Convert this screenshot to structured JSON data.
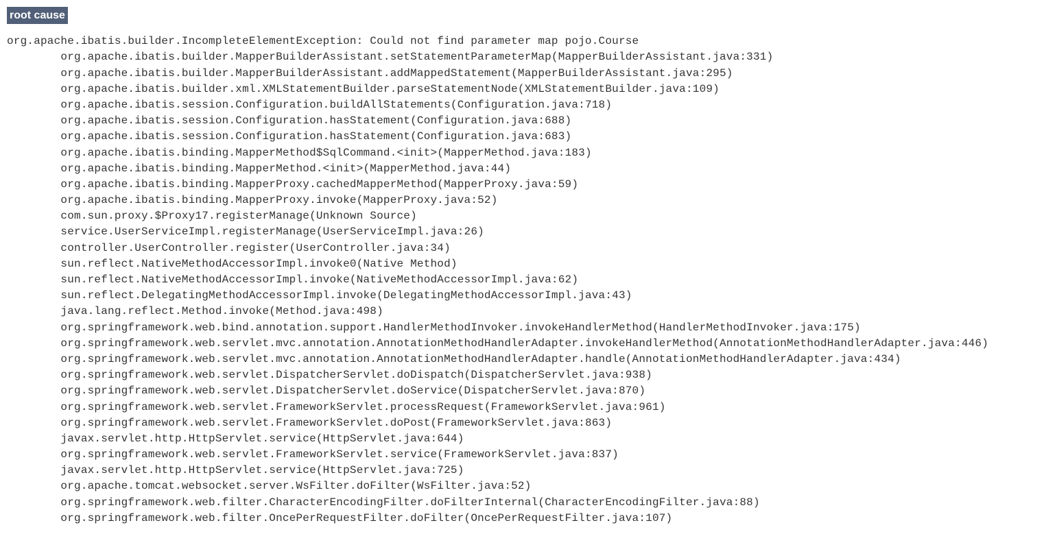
{
  "header": "root cause",
  "exceptionLine": "org.apache.ibatis.builder.IncompleteElementException: Could not find parameter map pojo.Course",
  "stack": [
    "org.apache.ibatis.builder.MapperBuilderAssistant.setStatementParameterMap(MapperBuilderAssistant.java:331)",
    "org.apache.ibatis.builder.MapperBuilderAssistant.addMappedStatement(MapperBuilderAssistant.java:295)",
    "org.apache.ibatis.builder.xml.XMLStatementBuilder.parseStatementNode(XMLStatementBuilder.java:109)",
    "org.apache.ibatis.session.Configuration.buildAllStatements(Configuration.java:718)",
    "org.apache.ibatis.session.Configuration.hasStatement(Configuration.java:688)",
    "org.apache.ibatis.session.Configuration.hasStatement(Configuration.java:683)",
    "org.apache.ibatis.binding.MapperMethod$SqlCommand.<init>(MapperMethod.java:183)",
    "org.apache.ibatis.binding.MapperMethod.<init>(MapperMethod.java:44)",
    "org.apache.ibatis.binding.MapperProxy.cachedMapperMethod(MapperProxy.java:59)",
    "org.apache.ibatis.binding.MapperProxy.invoke(MapperProxy.java:52)",
    "com.sun.proxy.$Proxy17.registerManage(Unknown Source)",
    "service.UserServiceImpl.registerManage(UserServiceImpl.java:26)",
    "controller.UserController.register(UserController.java:34)",
    "sun.reflect.NativeMethodAccessorImpl.invoke0(Native Method)",
    "sun.reflect.NativeMethodAccessorImpl.invoke(NativeMethodAccessorImpl.java:62)",
    "sun.reflect.DelegatingMethodAccessorImpl.invoke(DelegatingMethodAccessorImpl.java:43)",
    "java.lang.reflect.Method.invoke(Method.java:498)",
    "org.springframework.web.bind.annotation.support.HandlerMethodInvoker.invokeHandlerMethod(HandlerMethodInvoker.java:175)",
    "org.springframework.web.servlet.mvc.annotation.AnnotationMethodHandlerAdapter.invokeHandlerMethod(AnnotationMethodHandlerAdapter.java:446)",
    "org.springframework.web.servlet.mvc.annotation.AnnotationMethodHandlerAdapter.handle(AnnotationMethodHandlerAdapter.java:434)",
    "org.springframework.web.servlet.DispatcherServlet.doDispatch(DispatcherServlet.java:938)",
    "org.springframework.web.servlet.DispatcherServlet.doService(DispatcherServlet.java:870)",
    "org.springframework.web.servlet.FrameworkServlet.processRequest(FrameworkServlet.java:961)",
    "org.springframework.web.servlet.FrameworkServlet.doPost(FrameworkServlet.java:863)",
    "javax.servlet.http.HttpServlet.service(HttpServlet.java:644)",
    "org.springframework.web.servlet.FrameworkServlet.service(FrameworkServlet.java:837)",
    "javax.servlet.http.HttpServlet.service(HttpServlet.java:725)",
    "org.apache.tomcat.websocket.server.WsFilter.doFilter(WsFilter.java:52)",
    "org.springframework.web.filter.CharacterEncodingFilter.doFilterInternal(CharacterEncodingFilter.java:88)",
    "org.springframework.web.filter.OncePerRequestFilter.doFilter(OncePerRequestFilter.java:107)"
  ]
}
